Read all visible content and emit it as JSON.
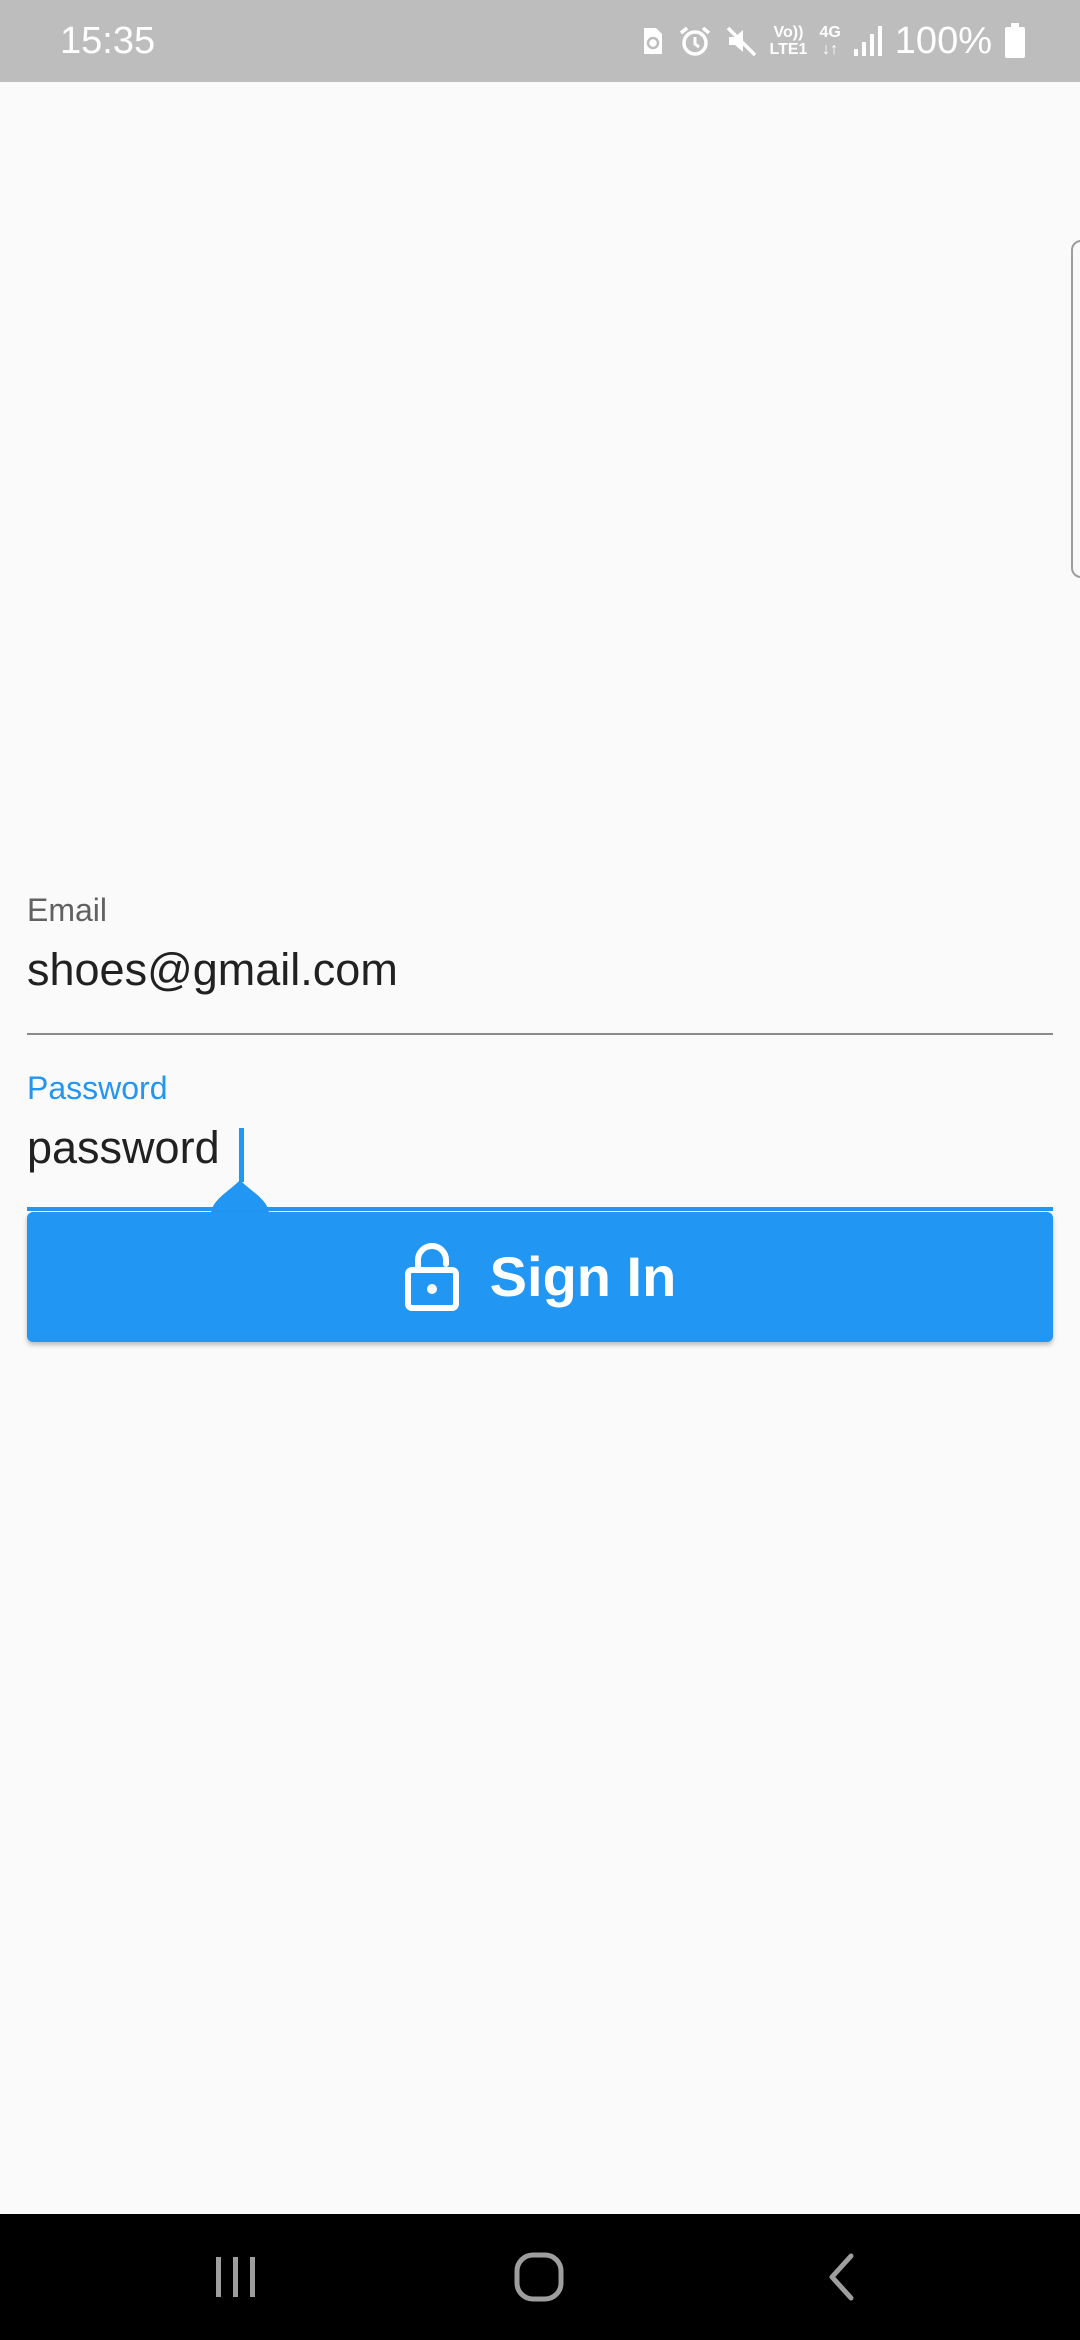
{
  "status_bar": {
    "time": "15:35",
    "network_label_top": "Vo))",
    "network_label_bottom": "LTE1",
    "data_type": "4G",
    "battery_percent": "100%",
    "icons": [
      "recycle-notification-icon",
      "alarm-icon",
      "mute-icon",
      "volte-icon",
      "4g-data-icon",
      "signal-icon",
      "battery-icon"
    ]
  },
  "form": {
    "email": {
      "label": "Email",
      "value": "shoes@gmail.com"
    },
    "password": {
      "label": "Password",
      "value": "password",
      "focused": true
    }
  },
  "sign_in_button": {
    "label": "Sign In",
    "icon": "lock-open-icon"
  },
  "nav_bar": {
    "buttons": [
      "recents-icon",
      "home-icon",
      "back-icon"
    ]
  },
  "colors": {
    "accent": "#2196f3",
    "status_bar": "#bdbdbd",
    "background": "#fafafa",
    "nav_bar": "#000000"
  }
}
